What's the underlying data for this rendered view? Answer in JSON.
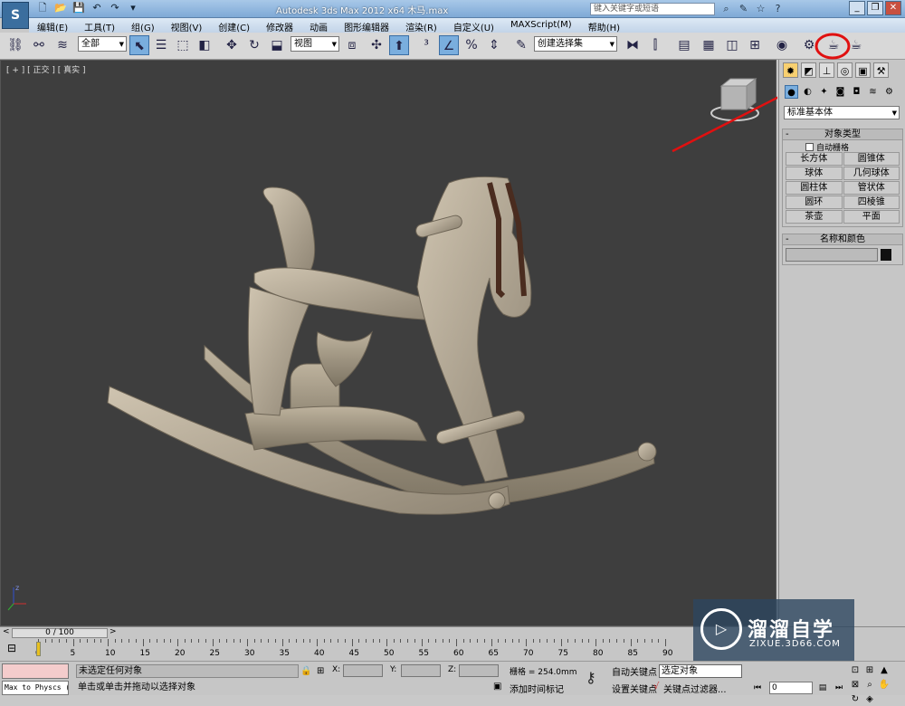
{
  "app": {
    "icon": "3ds-max-logo-icon",
    "title": "Autodesk 3ds Max  2012 x64     木马.max"
  },
  "search": {
    "placeholder": "键入关键字或短语"
  },
  "menu": [
    "编辑(E)",
    "工具(T)",
    "组(G)",
    "视图(V)",
    "创建(C)",
    "修改器",
    "动画",
    "图形编辑器",
    "渲染(R)",
    "自定义(U)",
    "MAXScript(M)",
    "帮助(H)"
  ],
  "toolbar": {
    "filter": "全部",
    "refcoord": "视图",
    "selset": "创建选择集"
  },
  "viewport": {
    "label": "[ + ] [ 正交 ] [ 真实 ]",
    "axis": "z"
  },
  "command_panel": {
    "dropdown": "标准基本体",
    "rollout_object_type": "对象类型",
    "autogrid": "自动栅格",
    "objects": [
      "长方体",
      "圆锥体",
      "球体",
      "几何球体",
      "圆柱体",
      "管状体",
      "圆环",
      "四棱锥",
      "茶壶",
      "平面"
    ],
    "rollout_name_color": "名称和颜色",
    "name_color": "#111111"
  },
  "timeline": {
    "slider": "0 / 100",
    "ticks": [
      "0",
      "5",
      "10",
      "15",
      "20",
      "25",
      "30",
      "35",
      "40",
      "45",
      "50",
      "55",
      "60",
      "65",
      "70",
      "75",
      "80",
      "85",
      "90"
    ]
  },
  "status": {
    "maxscript": "Max to Physcs (",
    "selection": "未选定任何对象",
    "prompt": "单击或单击并拖动以选择对象",
    "x": "X:",
    "y": "Y:",
    "z": "Z:",
    "grid": "栅格 = 254.0mm",
    "add_time_tag": "添加时间标记",
    "auto_key": "自动关键点",
    "set_key": "设置关键点",
    "selected": "选定对象",
    "key_filters": "关键点过滤器...",
    "frame": "0"
  },
  "watermark": {
    "title": "溜溜自学",
    "url": "ZIXUE.3D66.COM"
  }
}
